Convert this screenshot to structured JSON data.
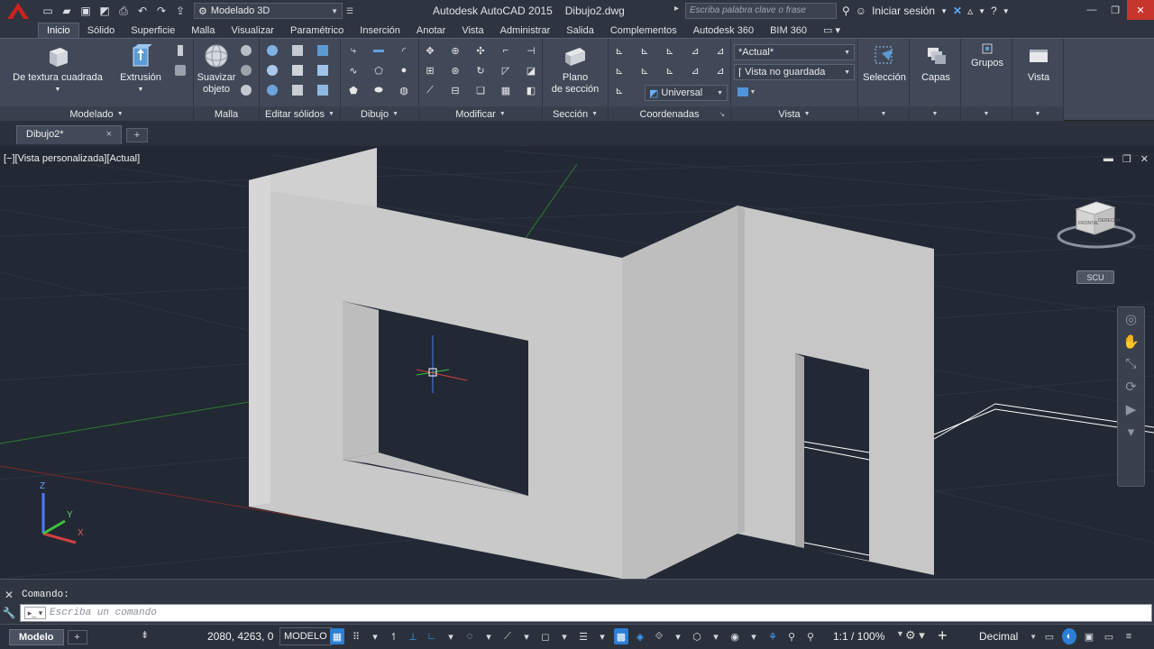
{
  "app": {
    "title": "Autodesk AutoCAD 2015",
    "document": "Dibujo2.dwg",
    "workspace": "Modelado 3D",
    "search_placeholder": "Escriba palabra clave o frase",
    "signin": "Iniciar sesión"
  },
  "ribbon_tabs": [
    "Inicio",
    "Sólido",
    "Superficie",
    "Malla",
    "Visualizar",
    "Paramétrico",
    "Inserción",
    "Anotar",
    "Vista",
    "Administrar",
    "Salida",
    "Complementos",
    "Autodesk 360",
    "BIM 360"
  ],
  "ribbon": {
    "modelado": {
      "title": "Modelado",
      "box": "De textura cuadrada",
      "extrusion": "Extrusión"
    },
    "malla": {
      "title": "Malla",
      "smooth_line1": "Suavizar",
      "smooth_line2": "objeto"
    },
    "editar_solidos": {
      "title": "Editar sólidos"
    },
    "dibujo": {
      "title": "Dibujo"
    },
    "modificar": {
      "title": "Modificar"
    },
    "seccion": {
      "title": "Sección",
      "plano_line1": "Plano",
      "plano_line2": "de sección"
    },
    "coordenadas": {
      "title": "Coordenadas",
      "ucs": "Universal"
    },
    "vista": {
      "title": "Vista",
      "visual_style": "*Actual*",
      "named_view": "Vista no guardada"
    },
    "seleccion": "Selección",
    "capas": "Capas",
    "grupos": "Grupos",
    "vista_btn": "Vista"
  },
  "doc_tab": {
    "label": "Dibujo2*",
    "close": "×",
    "add": "+"
  },
  "viewport": {
    "label": "[−][Vista personalizada][Actual]",
    "viewcube_front": "FRONTAL",
    "viewcube_right": "DERECHA",
    "scu": "SCU"
  },
  "command": {
    "history": "Comando:",
    "placeholder": "Escriba un comando"
  },
  "status": {
    "layout_tab": "Modelo",
    "coords": "2080, 4263, 0",
    "space": "MODELO",
    "scale": "1:1 / 100%",
    "units": "Decimal"
  }
}
